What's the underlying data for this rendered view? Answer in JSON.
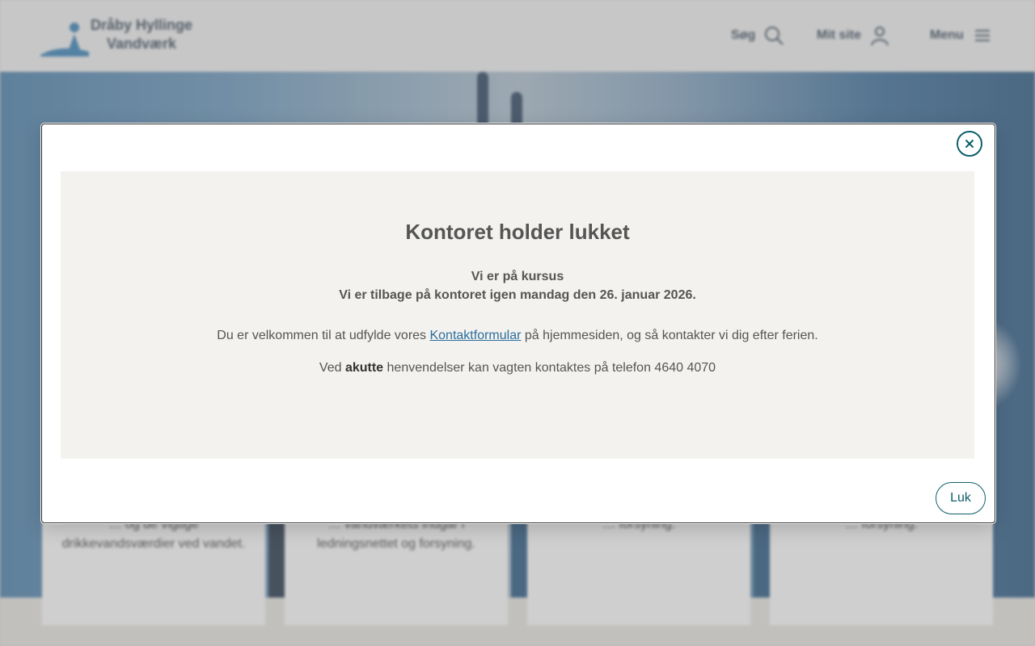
{
  "header": {
    "logo_text": "Dråby Hyllinge Vandværk",
    "nav": {
      "search_label": "Søg",
      "login_label": "Mit site",
      "menu_label": "Menu"
    }
  },
  "cards": [
    {
      "text": "… og de vigtige drikkevandsværdier ved vandet."
    },
    {
      "text": "… vandværkets indgår i ledningsnettet og forsyning."
    },
    {
      "text": "… forsyning."
    },
    {
      "text": "… forsyning."
    }
  ],
  "modal": {
    "close_icon": "close-icon",
    "title": "Kontoret holder lukket",
    "subtitle_line1": "Vi er på kursus",
    "subtitle_line2": "Vi er tilbage på kontoret igen mandag den 26. januar 2026.",
    "p1_before": "Du er velkommen til at udfylde vores ",
    "p1_link": "Kontaktformular",
    "p1_after": " på hjemmesiden, og så kontakter vi dig efter ferien.",
    "p2_before": "Ved ",
    "p2_bold": "akutte",
    "p2_after": " henvendelser kan vagten kontaktes på telefon 4640 4070",
    "luk_label": "Luk"
  },
  "colors": {
    "accent": "#0d5f6a",
    "link": "#2c6e9e",
    "notice_bg": "#f3f2ee"
  }
}
